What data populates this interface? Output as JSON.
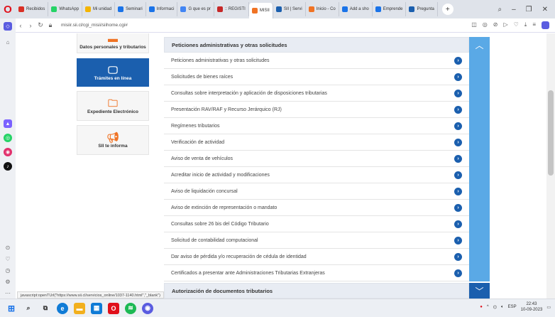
{
  "browser": {
    "tabs": [
      {
        "label": "Recibidos",
        "color": "#d93025",
        "active": false
      },
      {
        "label": "WhatsApp",
        "color": "#25d366",
        "active": false
      },
      {
        "label": "Mi unidad",
        "color": "#f4b400",
        "active": false
      },
      {
        "label": "Seminari",
        "color": "#1a73e8",
        "active": false
      },
      {
        "label": "Informaci",
        "color": "#1a73e8",
        "active": false
      },
      {
        "label": "G que es pr",
        "color": "#4285f4",
        "active": false
      },
      {
        "label": ":: REGISTI",
        "color": "#c62828",
        "active": false
      },
      {
        "label": "MISII",
        "color": "#f07324",
        "active": true
      },
      {
        "label": "SII | Servi",
        "color": "#1b5fae",
        "active": false
      },
      {
        "label": "Inicio - Co",
        "color": "#f07324",
        "active": false
      },
      {
        "label": "Add a sho",
        "color": "#1a73e8",
        "active": false
      },
      {
        "label": "Emprende",
        "color": "#1a73e8",
        "active": false
      },
      {
        "label": "Pregunta",
        "color": "#1b5fae",
        "active": false
      }
    ],
    "url": "misiir.sii.cl/cgi_misii/siihome.cgi#",
    "status_link": "javascript:openTUrl(\"https://www.sii.cl/servicios_online/1037-1140.html\",\"_blank\")"
  },
  "menu": {
    "tiles": [
      {
        "label": "Datos personales y tributarios",
        "icon": "person-icon",
        "active": false
      },
      {
        "label": "Trámites en línea",
        "icon": "laptop-icon",
        "active": true
      },
      {
        "label": "Expediente Electrónico",
        "icon": "folder-icon",
        "active": false
      },
      {
        "label": "SII te informa",
        "icon": "megaphone-icon",
        "active": false
      }
    ]
  },
  "panel": {
    "title": "Peticiones administrativas y otras solicitudes",
    "items": [
      "Peticiones administrativas y otras solicitudes",
      "Solicitudes de bienes raíces",
      "Consultas sobre interpretación y aplicación de disposiciones tributarias",
      "Presentación RAV/RAF y Recurso Jerárquico (RJ)",
      "Regímenes tributarios",
      "Verificación de actividad",
      "Aviso de venta de vehículos",
      "Acreditar inicio de actividad y modificaciones",
      "Aviso de liquidación concursal",
      "Aviso de extinción de representación o mandato",
      "Consultas sobre 26 bis del Código Tributario",
      "Solicitud de contabilidad computacional",
      "Dar aviso de pérdida y/o recuperación de cédula de identidad",
      "Certificados a presentar ante Administraciones Tributarias Extranjeras"
    ]
  },
  "panel2": {
    "title": "Autorización de documentos tributarios"
  },
  "taskbar": {
    "language": "ESP",
    "time": "22:43",
    "date": "10-09-2023"
  },
  "colors": {
    "primary": "#1b5fae",
    "accent": "#f07324",
    "panel_side": "#5aa9e6"
  }
}
